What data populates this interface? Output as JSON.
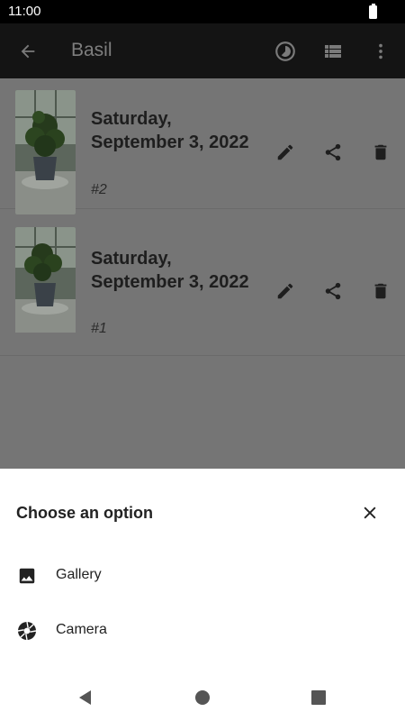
{
  "status_bar": {
    "time": "11:00"
  },
  "app_bar": {
    "title": "Basil"
  },
  "entries": [
    {
      "date": "Saturday, September 3, 2022",
      "number": "#2"
    },
    {
      "date": "Saturday, September 3, 2022",
      "number": "#1"
    }
  ],
  "sheet": {
    "title": "Choose an option",
    "options": [
      {
        "label": "Gallery",
        "icon": "image-icon"
      },
      {
        "label": "Camera",
        "icon": "camera-shutter-icon"
      }
    ]
  },
  "colors": {
    "app_bar": "#141414",
    "scrim_list": "#757575",
    "sheet": "#ffffff"
  }
}
